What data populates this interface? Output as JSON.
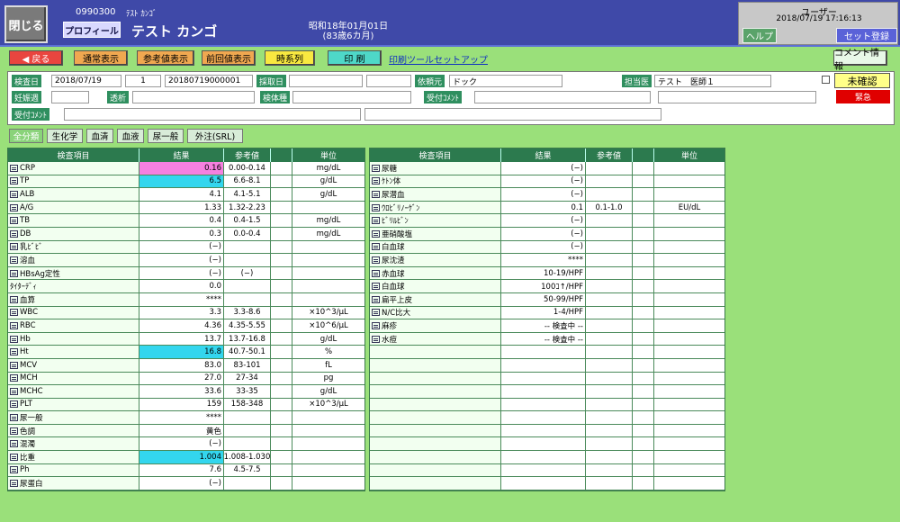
{
  "header": {
    "close": "閉じる",
    "patient_id": "0990300",
    "patient_kana": "ﾃｽﾄ ｶﾝｺﾞ",
    "profile": "プロフィール",
    "patient_name": "テスト カンゴ",
    "dob": "昭和18年01月01日",
    "age": "(83歳6カ月)",
    "user": "ユーザー",
    "datetime": "2018/07/19  17:16:13",
    "help": "ヘルプ",
    "set_register": "セット登録"
  },
  "toolbar": {
    "back": "◀ 戻る",
    "normal": "通常表示",
    "ref": "参考値表示",
    "prev": "前回値表示",
    "timeseries": "時系列",
    "print": "印 刷",
    "print_tool": "印刷ツールセットアップ",
    "comment_info": "コメント情報"
  },
  "form": {
    "exam_date_label": "検査日",
    "exam_date": "2018/07/19",
    "seq": "1",
    "exam_no": "20180719000001",
    "collect_label": "採取日",
    "collect": "",
    "requester_label": "依頼元",
    "requester": "ドック",
    "doctor_label": "担当医",
    "doctor": "テスト　医師１",
    "unconfirmed": "未確認",
    "pregnant_label": "妊娠週",
    "dialysis_label": "透析",
    "specimen_label": "検体種",
    "reception_comment_label": "受付ｺﾒﾝﾄ",
    "urgent": "緊急",
    "reception_comment2_label": "受付ｺﾒﾝﾄ"
  },
  "tabs": [
    "全分類",
    "生化学",
    "血清",
    "血液",
    "尿一般",
    "外注(SRL)"
  ],
  "colors": {
    "pink": "#f580e0",
    "cyan": "#33d6ee"
  },
  "left_headers": [
    "検査項目",
    "結果",
    "参考値",
    "",
    "単位"
  ],
  "left_rows": [
    {
      "name": "CRP",
      "result": "0.16",
      "ref": "0.00-0.14",
      "unit": "mg/dL",
      "hl": "pink",
      "icon": true
    },
    {
      "name": "TP",
      "result": "6.5",
      "ref": "6.6-8.1",
      "unit": "g/dL",
      "hl": "cyan",
      "icon": true
    },
    {
      "name": "ALB",
      "result": "4.1",
      "ref": "4.1-5.1",
      "unit": "g/dL",
      "icon": true
    },
    {
      "name": "A/G",
      "result": "1.33",
      "ref": "1.32-2.23",
      "unit": "",
      "icon": true
    },
    {
      "name": "TB",
      "result": "0.4",
      "ref": "0.4-1.5",
      "unit": "mg/dL",
      "icon": true
    },
    {
      "name": "DB",
      "result": "0.3",
      "ref": "0.0-0.4",
      "unit": "mg/dL",
      "icon": true
    },
    {
      "name": "乳ﾋﾞﾋﾞ",
      "result": "(−)",
      "ref": "",
      "unit": "",
      "icon": true
    },
    {
      "name": "溶血",
      "result": "(−)",
      "ref": "",
      "unit": "",
      "icon": true
    },
    {
      "name": "HBsAg定性",
      "result": "(−)",
      "ref": "(−)",
      "unit": "",
      "icon": true
    },
    {
      "name": "    ﾀｲﾀｰﾃﾞｨ",
      "result": "0.0",
      "ref": "",
      "unit": "",
      "icon": false
    },
    {
      "name": "血算",
      "result": "****",
      "ref": "",
      "unit": "",
      "icon": true
    },
    {
      "name": "WBC",
      "result": "3.3",
      "ref": "3.3-8.6",
      "unit": "×10^3/μL",
      "icon": true
    },
    {
      "name": "RBC",
      "result": "4.36",
      "ref": "4.35-5.55",
      "unit": "×10^6/μL",
      "icon": true
    },
    {
      "name": "Hb",
      "result": "13.7",
      "ref": "13.7-16.8",
      "unit": "g/dL",
      "icon": true
    },
    {
      "name": "Ht",
      "result": "16.8",
      "ref": "40.7-50.1",
      "unit": "%",
      "hl": "cyan",
      "icon": true
    },
    {
      "name": "MCV",
      "result": "83.0",
      "ref": "83-101",
      "unit": "fL",
      "icon": true
    },
    {
      "name": "MCH",
      "result": "27.0",
      "ref": "27-34",
      "unit": "pg",
      "icon": true
    },
    {
      "name": "MCHC",
      "result": "33.6",
      "ref": "33-35",
      "unit": "g/dL",
      "icon": true
    },
    {
      "name": "PLT",
      "result": "159",
      "ref": "158-348",
      "unit": "×10^3/μL",
      "icon": true
    },
    {
      "name": "尿一般",
      "result": "****",
      "ref": "",
      "unit": "",
      "icon": true
    },
    {
      "name": "色調",
      "result": "黄色",
      "ref": "",
      "unit": "",
      "icon": true
    },
    {
      "name": "混濁",
      "result": "(−)",
      "ref": "",
      "unit": "",
      "icon": true
    },
    {
      "name": "比重",
      "result": "1.004",
      "ref": "1.008-1.030",
      "unit": "",
      "hl": "cyan",
      "icon": true
    },
    {
      "name": "Ph",
      "result": "7.6",
      "ref": "4.5-7.5",
      "unit": "",
      "icon": true
    },
    {
      "name": "尿蛋白",
      "result": "(−)",
      "ref": "",
      "unit": "",
      "icon": true
    }
  ],
  "right_headers": [
    "検査項目",
    "結果",
    "参考値",
    "",
    "単位"
  ],
  "right_rows": [
    {
      "name": "尿糖",
      "result": "(−)",
      "ref": "",
      "unit": ""
    },
    {
      "name": "ｹﾄﾝ体",
      "result": "(−)",
      "ref": "",
      "unit": ""
    },
    {
      "name": "尿潜血",
      "result": "(−)",
      "ref": "",
      "unit": ""
    },
    {
      "name": "ｳﾛﾋﾞﾘﾉｰｹﾞﾝ",
      "result": "0.1",
      "ref": "0.1-1.0",
      "unit": "EU/dL"
    },
    {
      "name": "ﾋﾞﾘﾙﾋﾞﾝ",
      "result": "(−)",
      "ref": "",
      "unit": ""
    },
    {
      "name": "亜硝酸塩",
      "result": "(−)",
      "ref": "",
      "unit": ""
    },
    {
      "name": "白血球",
      "result": "(−)",
      "ref": "",
      "unit": ""
    },
    {
      "name": "尿沈渣",
      "result": "****",
      "ref": "",
      "unit": ""
    },
    {
      "name": "赤血球",
      "result": "10-19/HPF",
      "ref": "",
      "unit": ""
    },
    {
      "name": "白血球",
      "result": "100ｺ↑/HPF",
      "ref": "",
      "unit": ""
    },
    {
      "name": "扁平上皮",
      "result": "50-99/HPF",
      "ref": "",
      "unit": ""
    },
    {
      "name": "N/C比大",
      "result": "1-4/HPF",
      "ref": "",
      "unit": ""
    },
    {
      "name": "麻疹",
      "result": "-- 検査中 --",
      "ref": "",
      "unit": ""
    },
    {
      "name": "水痘",
      "result": "-- 検査中 --",
      "ref": "",
      "unit": ""
    }
  ]
}
